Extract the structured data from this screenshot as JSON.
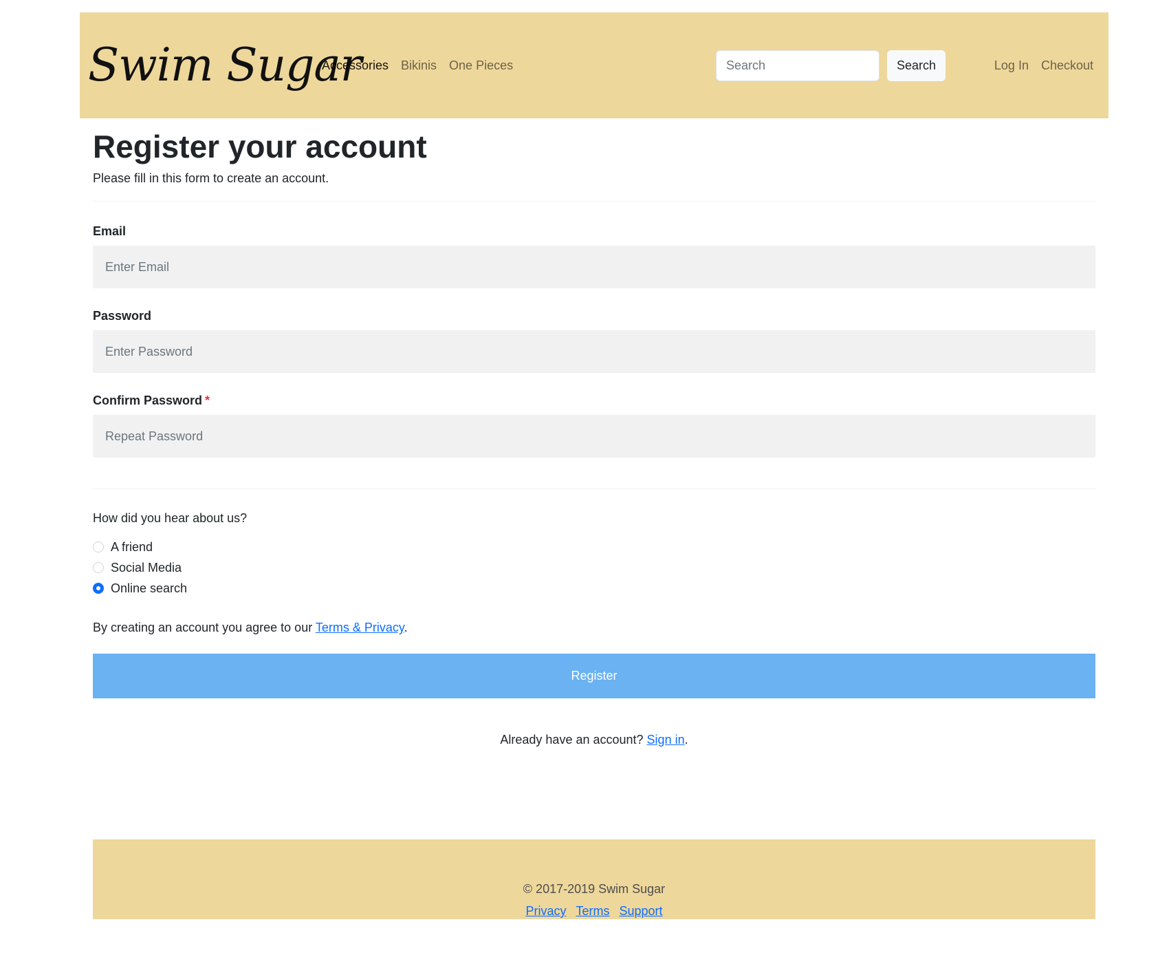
{
  "brand": {
    "name": "Swim Sugar"
  },
  "nav": {
    "items": [
      {
        "label": "Accessories"
      },
      {
        "label": "Bikinis"
      },
      {
        "label": "One Pieces"
      }
    ],
    "search": {
      "placeholder": "Search",
      "button_label": "Search"
    },
    "right_items": [
      {
        "label": "Log In"
      },
      {
        "label": "Checkout"
      }
    ]
  },
  "form": {
    "title": "Register your account",
    "subtitle": "Please fill in this form to create an account.",
    "email": {
      "label": "Email",
      "placeholder": "Enter Email",
      "value": ""
    },
    "password": {
      "label": "Password",
      "placeholder": "Enter Password",
      "value": ""
    },
    "confirm_password": {
      "label": "Confirm Password",
      "required_mark": "*",
      "placeholder": "Repeat Password",
      "value": ""
    },
    "referral": {
      "question": "How did you hear about us?",
      "options": [
        {
          "label": "A friend",
          "checked": false
        },
        {
          "label": "Social Media",
          "checked": false
        },
        {
          "label": "Online search",
          "checked": true
        }
      ]
    },
    "agreement": {
      "prefix": "By creating an account you agree to our ",
      "link_label": "Terms & Privacy",
      "suffix": "."
    },
    "register_label": "Register",
    "signin": {
      "prefix": "Already have an account? ",
      "link_label": "Sign in",
      "suffix": "."
    }
  },
  "footer": {
    "copyright": "© 2017-2019 Swim Sugar",
    "links": [
      {
        "label": "Privacy"
      },
      {
        "label": "Terms"
      },
      {
        "label": "Support"
      }
    ]
  },
  "colors": {
    "header_background": "#eed79b",
    "footer_background": "#eed79b",
    "register_button": "#6ab2f1",
    "link": "#0d6efd",
    "input_background": "#f1f1f1",
    "required_star": "#dc3545"
  }
}
